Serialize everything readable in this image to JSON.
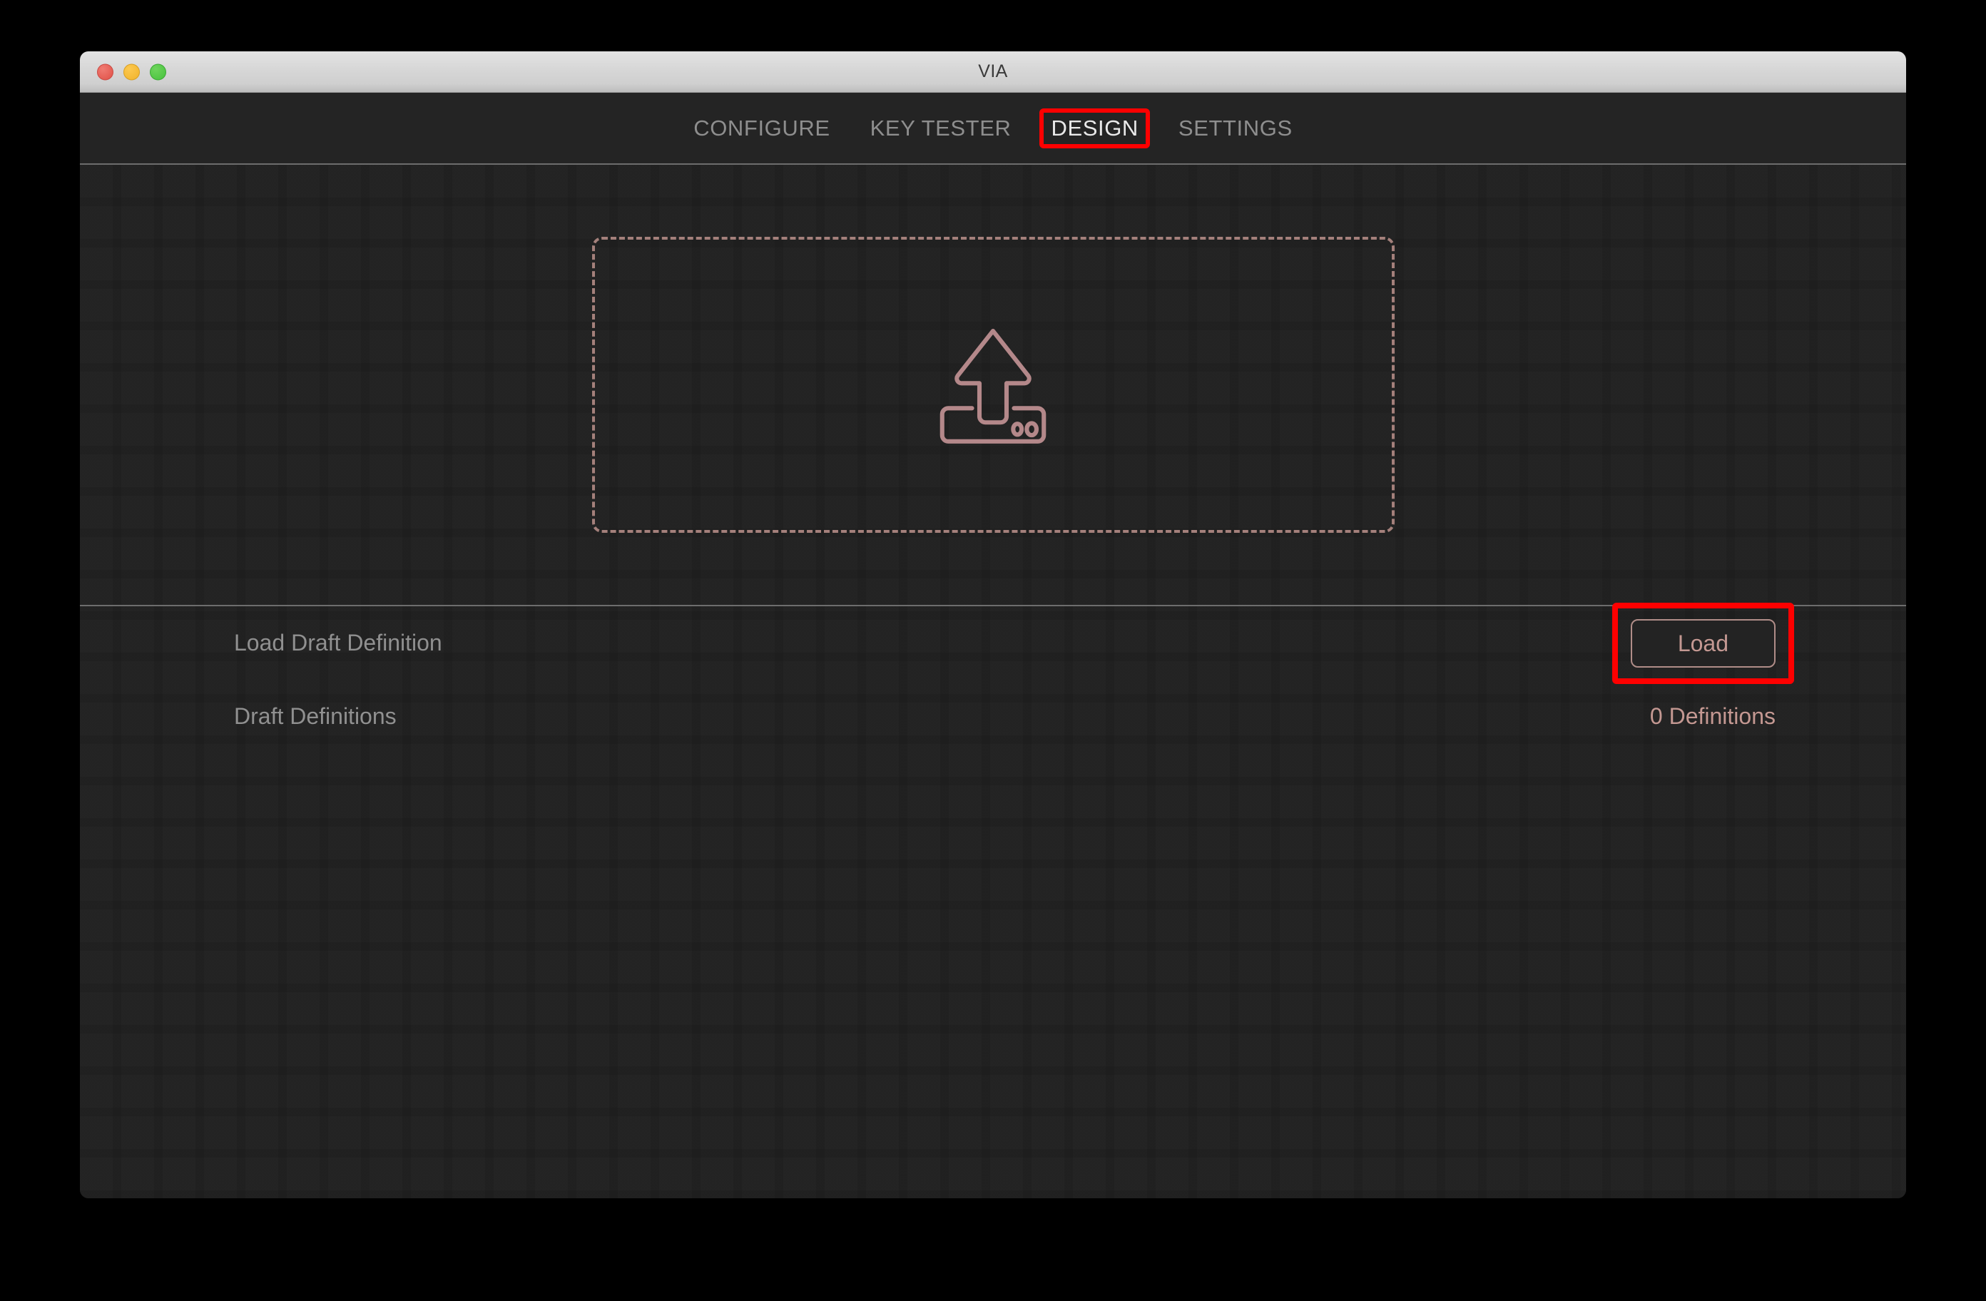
{
  "window": {
    "title": "VIA",
    "traffic_lights": [
      {
        "name": "close",
        "color": "#e05047"
      },
      {
        "name": "minimize",
        "color": "#f1b32b"
      },
      {
        "name": "maximize",
        "color": "#46c23c"
      }
    ]
  },
  "nav": {
    "tabs": [
      {
        "label": "CONFIGURE",
        "active": false,
        "highlighted": false
      },
      {
        "label": "KEY TESTER",
        "active": false,
        "highlighted": false
      },
      {
        "label": "DESIGN",
        "active": true,
        "highlighted": true
      },
      {
        "label": "SETTINGS",
        "active": false,
        "highlighted": false
      }
    ]
  },
  "main": {
    "dropzone": {
      "icon": "upload-keyboard-icon",
      "border_color": "#a4807b",
      "border_style": "dashed"
    },
    "settings_rows": [
      {
        "label": "Load Draft Definition",
        "control_type": "button",
        "button_label": "Load",
        "highlighted": true
      },
      {
        "label": "Draft Definitions",
        "control_type": "value",
        "value": "0 Definitions",
        "highlighted": false
      }
    ]
  },
  "theme": {
    "accent": "#c49892",
    "highlight_annotation": "#fe0000",
    "background": "#1e1e1e",
    "nav_background": "#242424",
    "label_text": "#909090"
  }
}
